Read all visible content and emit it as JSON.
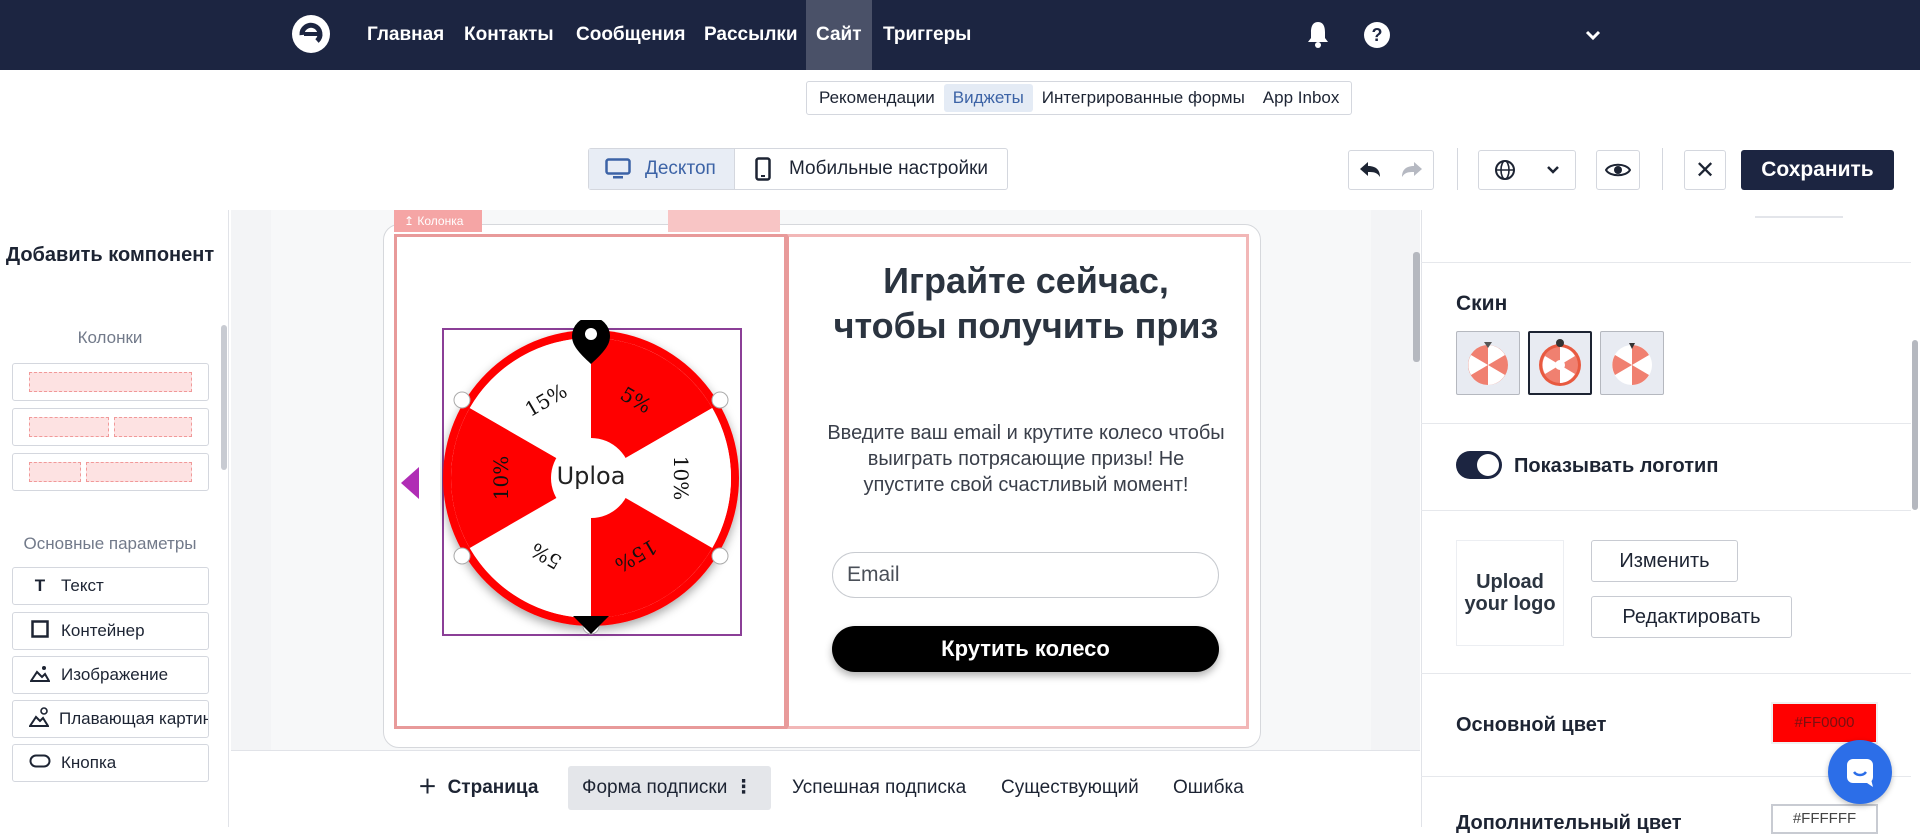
{
  "nav": {
    "items": [
      "Главная",
      "Контакты",
      "Сообщения",
      "Рассылки",
      "Сайт",
      "Триггеры"
    ],
    "active": "Сайт"
  },
  "subnav": {
    "items": [
      "Рекомендации",
      "Виджеты",
      "Интегрированные формы",
      "App Inbox"
    ],
    "active": "Виджеты"
  },
  "device": {
    "desktop": "Десктоп",
    "mobile": "Мобильные настройки"
  },
  "toolbar": {
    "save": "Сохранить",
    "close": "✕"
  },
  "left_panel": {
    "title": "Добавить компонент",
    "columns_label": "Колонки",
    "basic_label": "Основные параметры",
    "components": [
      {
        "icon": "text-icon",
        "label": "Текст"
      },
      {
        "icon": "container-icon",
        "label": "Контейнер"
      },
      {
        "icon": "image-icon",
        "label": "Изображение"
      },
      {
        "icon": "floating-image-icon",
        "label": "Плавающая картинка"
      },
      {
        "icon": "button-icon",
        "label": "Кнопка"
      }
    ]
  },
  "canvas": {
    "column_badge": "Колонка",
    "wheel": {
      "segments": [
        "5%",
        "10%",
        "15%",
        "5%",
        "10%",
        "15%"
      ],
      "center_text": "Uploa"
    },
    "heading": "Играйте сейчас, чтобы получить приз",
    "description": "Введите ваш email и крутите колесо чтобы выиграть потрясающие призы! Не упустите свой счастливый момент!",
    "email_placeholder": "Email",
    "spin_button": "Крутить колесо"
  },
  "page_tabs": {
    "add": "Страница",
    "tabs": [
      "Форма подписки",
      "Успешная подписка",
      "Существующий",
      "Ошибка"
    ],
    "active": "Форма подписки"
  },
  "right_panel": {
    "skin_label": "Скин",
    "show_logo_label": "Показывать логотип",
    "show_logo": true,
    "logo_placeholder": "Upload your logo",
    "change_button": "Изменить",
    "edit_button": "Редактировать",
    "main_color_label": "Основной цвет",
    "main_color": "#FF0000",
    "secondary_color_label": "Дополнительный цвет",
    "secondary_color": "#FFFFFF"
  },
  "colors": {
    "nav_bg": "#1c2541",
    "accent": "#3c63a6",
    "wheel_red": "#ff0000"
  }
}
